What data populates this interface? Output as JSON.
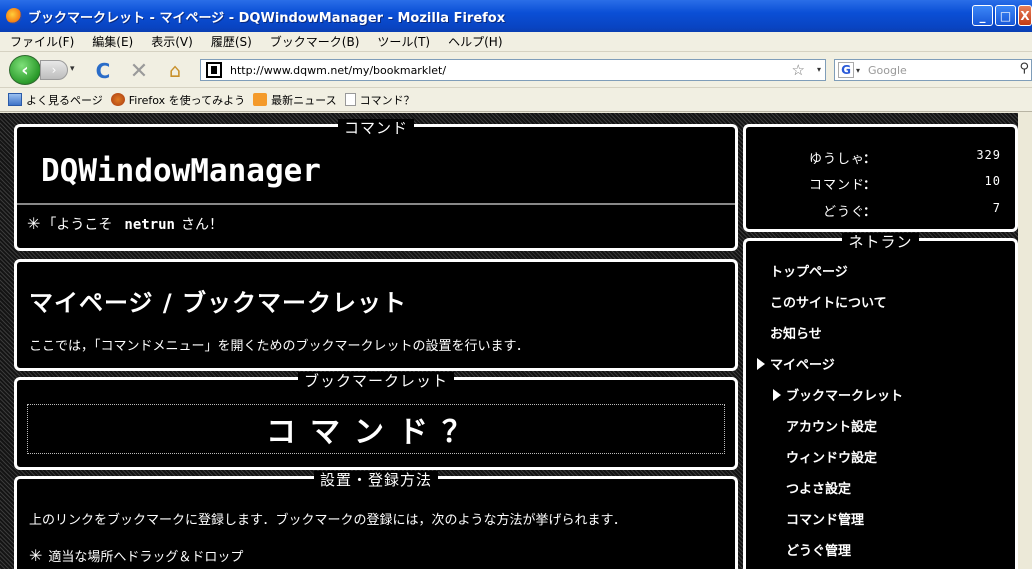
{
  "window": {
    "title": "ブックマークレット - マイページ - DQWindowManager - Mozilla Firefox",
    "min_label": "_",
    "max_label": "□",
    "close_label": "X"
  },
  "menubar": {
    "items": [
      "ファイル(F)",
      "編集(E)",
      "表示(V)",
      "履歴(S)",
      "ブックマーク(B)",
      "ツール(T)",
      "ヘルプ(H)"
    ]
  },
  "toolbar": {
    "back_glyph": "‹",
    "forward_glyph": "›",
    "dropdown_glyph": "▾",
    "reload_glyph": "C",
    "stop_glyph": "✕",
    "home_glyph": "⌂",
    "url": "http://www.dqwm.net/my/bookmarklet/",
    "bookmark_star_glyph": "☆",
    "search_engine_glyph": "G",
    "search_placeholder": "Google",
    "search_glyph": "⚲"
  },
  "bookmarks_bar": {
    "items": [
      {
        "label": "よく見るページ",
        "icon": "folder-icon"
      },
      {
        "label": "Firefox を使ってみよう",
        "icon": "firefox-icon"
      },
      {
        "label": "最新ニュース",
        "icon": "rss-icon"
      },
      {
        "label": "コマンド？",
        "icon": "page-icon"
      }
    ]
  },
  "header_panel": {
    "title": "コマンド",
    "logo": "DQWindowManager",
    "greeting_mark": "✳",
    "greeting_prefix": "「ようこそ",
    "username": "netrun",
    "greeting_suffix": "さん！"
  },
  "page_panel": {
    "heading": "マイページ / ブックマークレット",
    "description": "ここでは，「コマンドメニュー」を開くためのブックマークレットの設置を行います．"
  },
  "bookmarklet_panel": {
    "title": "ブックマークレット",
    "link_label": "コマンド？"
  },
  "install_panel": {
    "title": "設置・登録方法",
    "text": "上のリンクをブックマークに登録します．ブックマークの登録には，次のような方法が挙げられます．",
    "item_mark": "✳",
    "item": "適当な場所へドラッグ＆ドロップ"
  },
  "stats_panel": {
    "colon": "：",
    "rows": [
      {
        "label": "ゆうしゃ",
        "value": "329"
      },
      {
        "label": "コマンド",
        "value": "10"
      },
      {
        "label": "どうぐ",
        "value": "7"
      }
    ]
  },
  "nav_panel": {
    "title": "ネトラン",
    "items": [
      {
        "label": "トップページ"
      },
      {
        "label": "このサイトについて"
      },
      {
        "label": "お知らせ"
      },
      {
        "label": "マイページ"
      },
      {
        "label": "ブックマークレット"
      },
      {
        "label": "アカウント設定"
      },
      {
        "label": "ウィンドウ設定"
      },
      {
        "label": "つよさ設定"
      },
      {
        "label": "コマンド管理"
      },
      {
        "label": "どうぐ管理"
      }
    ]
  },
  "colors": {
    "titlebar": "#0a4fd6",
    "page_bg": "#000000",
    "panel_border": "#ffffff",
    "text": "#ffffff"
  }
}
